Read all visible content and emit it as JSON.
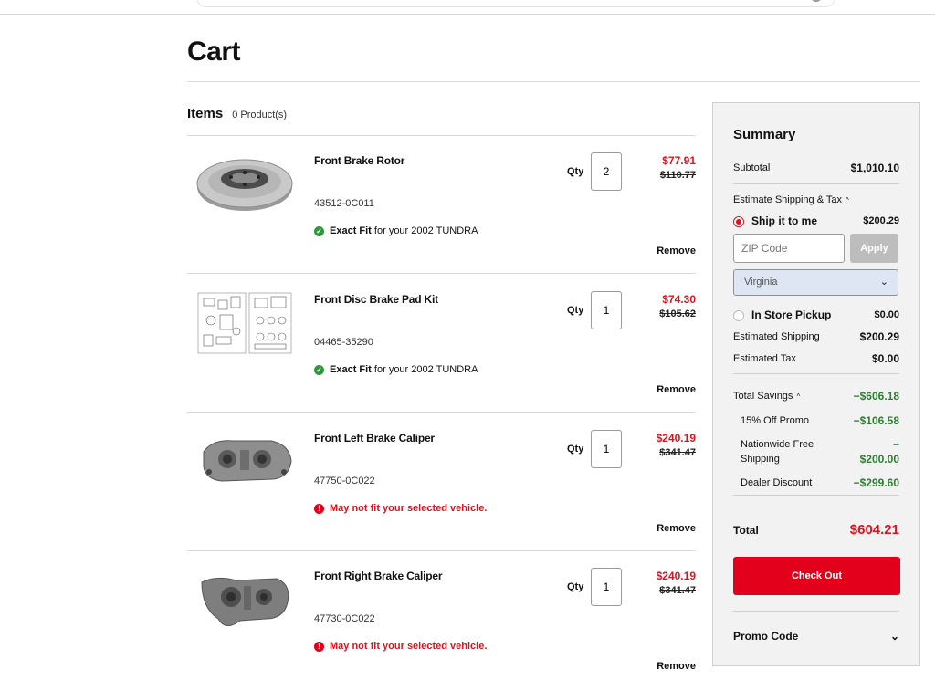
{
  "page": {
    "title": "Cart"
  },
  "items_header": {
    "label": "Items",
    "count": "0 Product(s)"
  },
  "labels": {
    "qty": "Qty",
    "remove": "Remove",
    "exact_fit": "Exact Fit"
  },
  "items": [
    {
      "name": "Front Brake Rotor",
      "part": "43512-0C011",
      "qty": "2",
      "price": "$77.91",
      "was": "$110.77",
      "fit_ok": true,
      "fit_rest": "for your 2002 TUNDRA",
      "icon": "brake-rotor"
    },
    {
      "name": "Front Disc Brake Pad Kit",
      "part": "04465-35290",
      "qty": "1",
      "price": "$74.30",
      "was": "$105.62",
      "fit_ok": true,
      "fit_rest": "for your 2002 TUNDRA",
      "icon": "brake-pad-diagram"
    },
    {
      "name": "Front Left Brake Caliper",
      "part": "47750-0C022",
      "qty": "1",
      "price": "$240.19",
      "was": "$341.47",
      "fit_ok": false,
      "fit_msg": "May not fit your selected vehicle.",
      "icon": "brake-caliper"
    },
    {
      "name": "Front Right Brake Caliper",
      "part": "47730-0C022",
      "qty": "1",
      "price": "$240.19",
      "was": "$341.47",
      "fit_ok": false,
      "fit_msg": "May not fit your selected vehicle.",
      "icon": "brake-caliper"
    }
  ],
  "summary": {
    "title": "Summary",
    "subtotal_label": "Subtotal",
    "subtotal": "$1,010.10",
    "estimate_label": "Estimate Shipping & Tax",
    "ship_label": "Ship it to me",
    "ship_value": "$200.29",
    "zip_placeholder": "ZIP Code",
    "apply_label": "Apply",
    "state": "Virginia",
    "pickup_label": "In Store Pickup",
    "pickup_value": "$0.00",
    "est_shipping_label": "Estimated Shipping",
    "est_shipping": "$200.29",
    "est_tax_label": "Estimated Tax",
    "est_tax": "$0.00",
    "savings_label": "Total Savings",
    "savings": "−$606.18",
    "promo15_label": "15% Off Promo",
    "promo15": "−$106.58",
    "freeship_label_1": "Nationwide Free",
    "freeship_label_2": "Shipping",
    "freeship_dash": "−",
    "freeship": "$200.00",
    "dealer_label": "Dealer Discount",
    "dealer": "−$299.60",
    "total_label": "Total",
    "total": "$604.21",
    "checkout_label": "Check Out",
    "promo_code_label": "Promo Code"
  },
  "colors": {
    "accent_red": "#e3001b",
    "savings_green": "#2e7d32"
  }
}
